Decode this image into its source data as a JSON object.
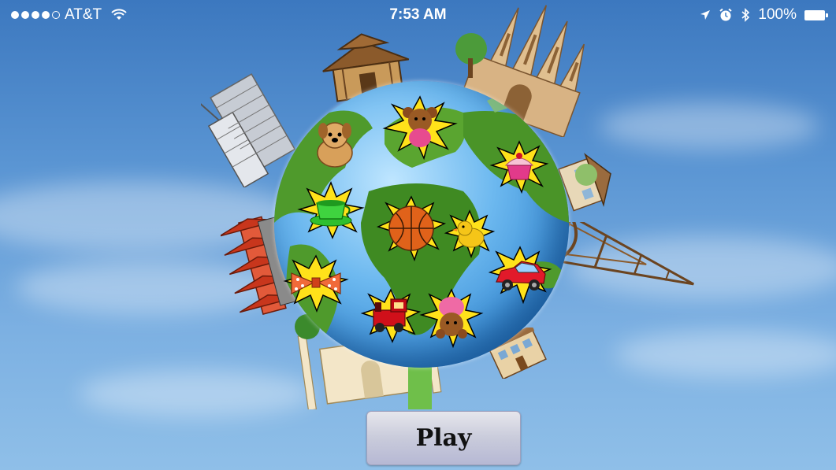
{
  "status_bar": {
    "carrier": "AT&T",
    "signal_bars_filled": 4,
    "signal_bars_total": 5,
    "time": "7:53 AM",
    "battery_percent": "100%",
    "icons": [
      "wifi-icon",
      "location-arrow-icon",
      "alarm-icon",
      "bluetooth-icon",
      "battery-icon"
    ]
  },
  "main": {
    "play_label": "Play",
    "globe_items": [
      "teddy-bear-brown-icon",
      "puppy-icon",
      "cupcake-icon",
      "teacup-icon",
      "basketball-icon",
      "rubber-duck-icon",
      "toy-car-icon",
      "bow-tie-icon",
      "toy-train-icon",
      "teddy-bear-pink-icon"
    ],
    "landmarks": [
      "skyscraper-icon",
      "pagoda-house-icon",
      "cathedral-icon",
      "cottage-icon",
      "eiffel-tower-icon",
      "chinese-tower-icon",
      "taj-mahal-icon",
      "townhouse-icon"
    ]
  },
  "colors": {
    "sky": "#5a95d3",
    "ocean": "#2d83cf",
    "land": "#4f9a2c",
    "button": "#c9cbdb",
    "burst": "#ffe21a"
  }
}
